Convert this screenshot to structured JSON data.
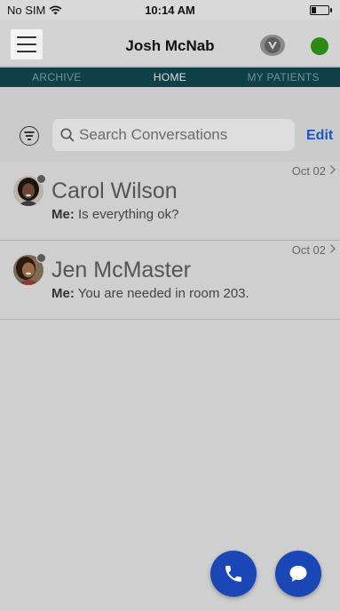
{
  "status_bar": {
    "carrier": "No SIM",
    "time": "10:14 AM"
  },
  "header": {
    "title": "Josh McNab"
  },
  "tabs": [
    {
      "label": "ARCHIVE",
      "active": false
    },
    {
      "label": "HOME",
      "active": true
    },
    {
      "label": "MY PATIENTS",
      "active": false
    }
  ],
  "search": {
    "placeholder": "Search Conversations",
    "value": ""
  },
  "edit_label": "Edit",
  "conversations": [
    {
      "name": "Carol Wilson",
      "sender": "Me:",
      "message": "Is everything ok?",
      "date": "Oct 02"
    },
    {
      "name": "Jen McMaster",
      "sender": "Me:",
      "message": "You are needed in room 203.",
      "date": "Oct 02"
    }
  ],
  "colors": {
    "tab_bar": "#0f4047",
    "accent": "#1f55c4",
    "fab": "#1a47b5",
    "online": "#2b8a10"
  },
  "icons": [
    "wifi-icon",
    "battery-icon",
    "menu-icon",
    "shield-logo-icon",
    "filter-icon",
    "search-icon",
    "chevron-right-icon",
    "phone-icon",
    "chat-bubble-icon"
  ]
}
